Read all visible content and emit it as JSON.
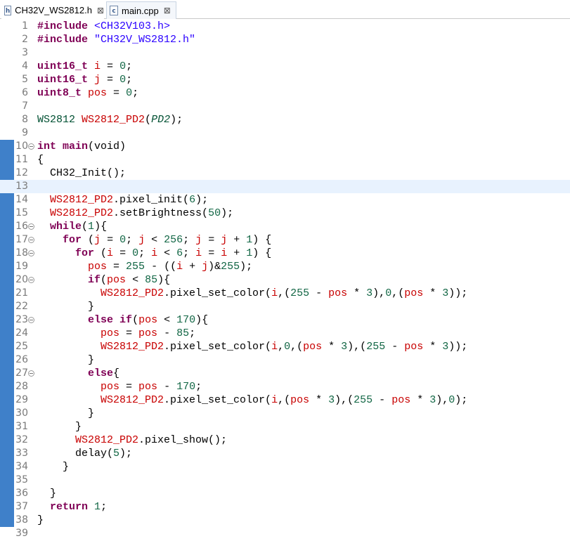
{
  "tabs": [
    {
      "label": "CH32V_WS2812.h",
      "icon": "h-file-icon",
      "icon_glyph": "h",
      "active": false
    },
    {
      "label": "main.cpp",
      "icon": "cpp-file-icon",
      "icon_glyph": "c",
      "active": true
    }
  ],
  "close_glyph": "⊠",
  "current_line": 13,
  "fold_lines": [
    10,
    16,
    17,
    18,
    20,
    23,
    27
  ],
  "band_start_line": 10,
  "band_end_line": 38,
  "lines": [
    [
      {
        "t": "#include",
        "c": "ppk"
      },
      {
        "t": " "
      },
      {
        "t": "<CH32V103.h>",
        "c": "str"
      }
    ],
    [
      {
        "t": "#include",
        "c": "ppk"
      },
      {
        "t": " "
      },
      {
        "t": "\"CH32V_WS2812.h\"",
        "c": "str"
      }
    ],
    [],
    [
      {
        "t": "uint16_t",
        "c": "kw"
      },
      {
        "t": " "
      },
      {
        "t": "i",
        "c": "var"
      },
      {
        "t": " = "
      },
      {
        "t": "0",
        "c": "num"
      },
      {
        "t": ";"
      }
    ],
    [
      {
        "t": "uint16_t",
        "c": "kw"
      },
      {
        "t": " "
      },
      {
        "t": "j",
        "c": "var"
      },
      {
        "t": " = "
      },
      {
        "t": "0",
        "c": "num"
      },
      {
        "t": ";"
      }
    ],
    [
      {
        "t": "uint8_t",
        "c": "kw"
      },
      {
        "t": " "
      },
      {
        "t": "pos",
        "c": "var"
      },
      {
        "t": " = "
      },
      {
        "t": "0",
        "c": "num"
      },
      {
        "t": ";"
      }
    ],
    [],
    [
      {
        "t": "WS2812",
        "c": "cls"
      },
      {
        "t": " "
      },
      {
        "t": "WS2812_PD2",
        "c": "var"
      },
      {
        "t": "("
      },
      {
        "t": "PD2",
        "c": "prm"
      },
      {
        "t": ");"
      }
    ],
    [],
    [
      {
        "t": "int",
        "c": "kw"
      },
      {
        "t": " "
      },
      {
        "t": "main",
        "c": "kw"
      },
      {
        "t": "(void)"
      }
    ],
    [
      {
        "t": "{"
      }
    ],
    [
      {
        "t": "  CH32_Init();"
      }
    ],
    [],
    [
      {
        "t": "  "
      },
      {
        "t": "WS2812_PD2",
        "c": "var"
      },
      {
        "t": ".pixel_init("
      },
      {
        "t": "6",
        "c": "num"
      },
      {
        "t": ");"
      }
    ],
    [
      {
        "t": "  "
      },
      {
        "t": "WS2812_PD2",
        "c": "var"
      },
      {
        "t": ".setBrightness("
      },
      {
        "t": "50",
        "c": "num"
      },
      {
        "t": ");"
      }
    ],
    [
      {
        "t": "  "
      },
      {
        "t": "while",
        "c": "kw"
      },
      {
        "t": "("
      },
      {
        "t": "1",
        "c": "num"
      },
      {
        "t": "){"
      }
    ],
    [
      {
        "t": "    "
      },
      {
        "t": "for",
        "c": "kw"
      },
      {
        "t": " ("
      },
      {
        "t": "j",
        "c": "var"
      },
      {
        "t": " = "
      },
      {
        "t": "0",
        "c": "num"
      },
      {
        "t": "; "
      },
      {
        "t": "j",
        "c": "var"
      },
      {
        "t": " < "
      },
      {
        "t": "256",
        "c": "num"
      },
      {
        "t": "; "
      },
      {
        "t": "j",
        "c": "var"
      },
      {
        "t": " = "
      },
      {
        "t": "j",
        "c": "var"
      },
      {
        "t": " + "
      },
      {
        "t": "1",
        "c": "num"
      },
      {
        "t": ") {"
      }
    ],
    [
      {
        "t": "      "
      },
      {
        "t": "for",
        "c": "kw"
      },
      {
        "t": " ("
      },
      {
        "t": "i",
        "c": "var"
      },
      {
        "t": " = "
      },
      {
        "t": "0",
        "c": "num"
      },
      {
        "t": "; "
      },
      {
        "t": "i",
        "c": "var"
      },
      {
        "t": " < "
      },
      {
        "t": "6",
        "c": "num"
      },
      {
        "t": "; "
      },
      {
        "t": "i",
        "c": "var"
      },
      {
        "t": " = "
      },
      {
        "t": "i",
        "c": "var"
      },
      {
        "t": " + "
      },
      {
        "t": "1",
        "c": "num"
      },
      {
        "t": ") {"
      }
    ],
    [
      {
        "t": "        "
      },
      {
        "t": "pos",
        "c": "var"
      },
      {
        "t": " = "
      },
      {
        "t": "255",
        "c": "num"
      },
      {
        "t": " - (("
      },
      {
        "t": "i",
        "c": "var"
      },
      {
        "t": " + "
      },
      {
        "t": "j",
        "c": "var"
      },
      {
        "t": ")&"
      },
      {
        "t": "255",
        "c": "num"
      },
      {
        "t": ");"
      }
    ],
    [
      {
        "t": "        "
      },
      {
        "t": "if",
        "c": "kw"
      },
      {
        "t": "("
      },
      {
        "t": "pos",
        "c": "var"
      },
      {
        "t": " < "
      },
      {
        "t": "85",
        "c": "num"
      },
      {
        "t": "){"
      }
    ],
    [
      {
        "t": "          "
      },
      {
        "t": "WS2812_PD2",
        "c": "var"
      },
      {
        "t": ".pixel_set_color("
      },
      {
        "t": "i",
        "c": "var"
      },
      {
        "t": ",("
      },
      {
        "t": "255",
        "c": "num"
      },
      {
        "t": " - "
      },
      {
        "t": "pos",
        "c": "var"
      },
      {
        "t": " * "
      },
      {
        "t": "3",
        "c": "num"
      },
      {
        "t": "),"
      },
      {
        "t": "0",
        "c": "num"
      },
      {
        "t": ",("
      },
      {
        "t": "pos",
        "c": "var"
      },
      {
        "t": " * "
      },
      {
        "t": "3",
        "c": "num"
      },
      {
        "t": "));"
      }
    ],
    [
      {
        "t": "        }"
      }
    ],
    [
      {
        "t": "        "
      },
      {
        "t": "else",
        "c": "kw"
      },
      {
        "t": " "
      },
      {
        "t": "if",
        "c": "kw"
      },
      {
        "t": "("
      },
      {
        "t": "pos",
        "c": "var"
      },
      {
        "t": " < "
      },
      {
        "t": "170",
        "c": "num"
      },
      {
        "t": "){"
      }
    ],
    [
      {
        "t": "          "
      },
      {
        "t": "pos",
        "c": "var"
      },
      {
        "t": " = "
      },
      {
        "t": "pos",
        "c": "var"
      },
      {
        "t": " - "
      },
      {
        "t": "85",
        "c": "num"
      },
      {
        "t": ";"
      }
    ],
    [
      {
        "t": "          "
      },
      {
        "t": "WS2812_PD2",
        "c": "var"
      },
      {
        "t": ".pixel_set_color("
      },
      {
        "t": "i",
        "c": "var"
      },
      {
        "t": ","
      },
      {
        "t": "0",
        "c": "num"
      },
      {
        "t": ",("
      },
      {
        "t": "pos",
        "c": "var"
      },
      {
        "t": " * "
      },
      {
        "t": "3",
        "c": "num"
      },
      {
        "t": "),("
      },
      {
        "t": "255",
        "c": "num"
      },
      {
        "t": " - "
      },
      {
        "t": "pos",
        "c": "var"
      },
      {
        "t": " * "
      },
      {
        "t": "3",
        "c": "num"
      },
      {
        "t": "));"
      }
    ],
    [
      {
        "t": "        }"
      }
    ],
    [
      {
        "t": "        "
      },
      {
        "t": "else",
        "c": "kw"
      },
      {
        "t": "{"
      }
    ],
    [
      {
        "t": "          "
      },
      {
        "t": "pos",
        "c": "var"
      },
      {
        "t": " = "
      },
      {
        "t": "pos",
        "c": "var"
      },
      {
        "t": " - "
      },
      {
        "t": "170",
        "c": "num"
      },
      {
        "t": ";"
      }
    ],
    [
      {
        "t": "          "
      },
      {
        "t": "WS2812_PD2",
        "c": "var"
      },
      {
        "t": ".pixel_set_color("
      },
      {
        "t": "i",
        "c": "var"
      },
      {
        "t": ",("
      },
      {
        "t": "pos",
        "c": "var"
      },
      {
        "t": " * "
      },
      {
        "t": "3",
        "c": "num"
      },
      {
        "t": "),("
      },
      {
        "t": "255",
        "c": "num"
      },
      {
        "t": " - "
      },
      {
        "t": "pos",
        "c": "var"
      },
      {
        "t": " * "
      },
      {
        "t": "3",
        "c": "num"
      },
      {
        "t": "),"
      },
      {
        "t": "0",
        "c": "num"
      },
      {
        "t": ");"
      }
    ],
    [
      {
        "t": "        }"
      }
    ],
    [
      {
        "t": "      }"
      }
    ],
    [
      {
        "t": "      "
      },
      {
        "t": "WS2812_PD2",
        "c": "var"
      },
      {
        "t": ".pixel_show();"
      }
    ],
    [
      {
        "t": "      delay("
      },
      {
        "t": "5",
        "c": "num"
      },
      {
        "t": ");"
      }
    ],
    [
      {
        "t": "    }"
      }
    ],
    [],
    [
      {
        "t": "  }"
      }
    ],
    [
      {
        "t": "  "
      },
      {
        "t": "return",
        "c": "kw"
      },
      {
        "t": " "
      },
      {
        "t": "1",
        "c": "num"
      },
      {
        "t": ";"
      }
    ],
    [
      {
        "t": "}"
      }
    ],
    []
  ]
}
